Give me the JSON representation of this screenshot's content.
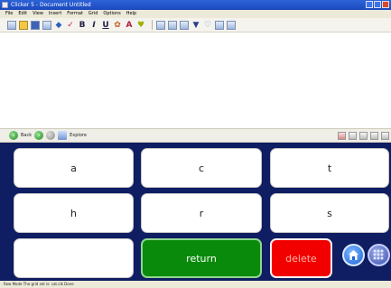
{
  "window": {
    "title": "Clicker 5 - Document Untitled"
  },
  "menu": [
    "File",
    "Edit",
    "View",
    "Insert",
    "Format",
    "Grid",
    "Options",
    "Help"
  ],
  "toolbar": {
    "bold": "B",
    "italic": "I",
    "underline": "U"
  },
  "grid_toolbar": {
    "back_label": "Back",
    "explore_label": "Explore"
  },
  "grid": {
    "rows": [
      [
        "a",
        "c",
        "t"
      ],
      [
        "h",
        "r",
        "s"
      ]
    ],
    "blank_label": "",
    "return_label": "return",
    "delete_label": "delete",
    "colors": {
      "background": "#0f1d62",
      "return": "#0a8a0a",
      "delete": "#f20000"
    }
  },
  "status": {
    "text": "Row Mode  The grid set is: cat.clk  Done"
  }
}
